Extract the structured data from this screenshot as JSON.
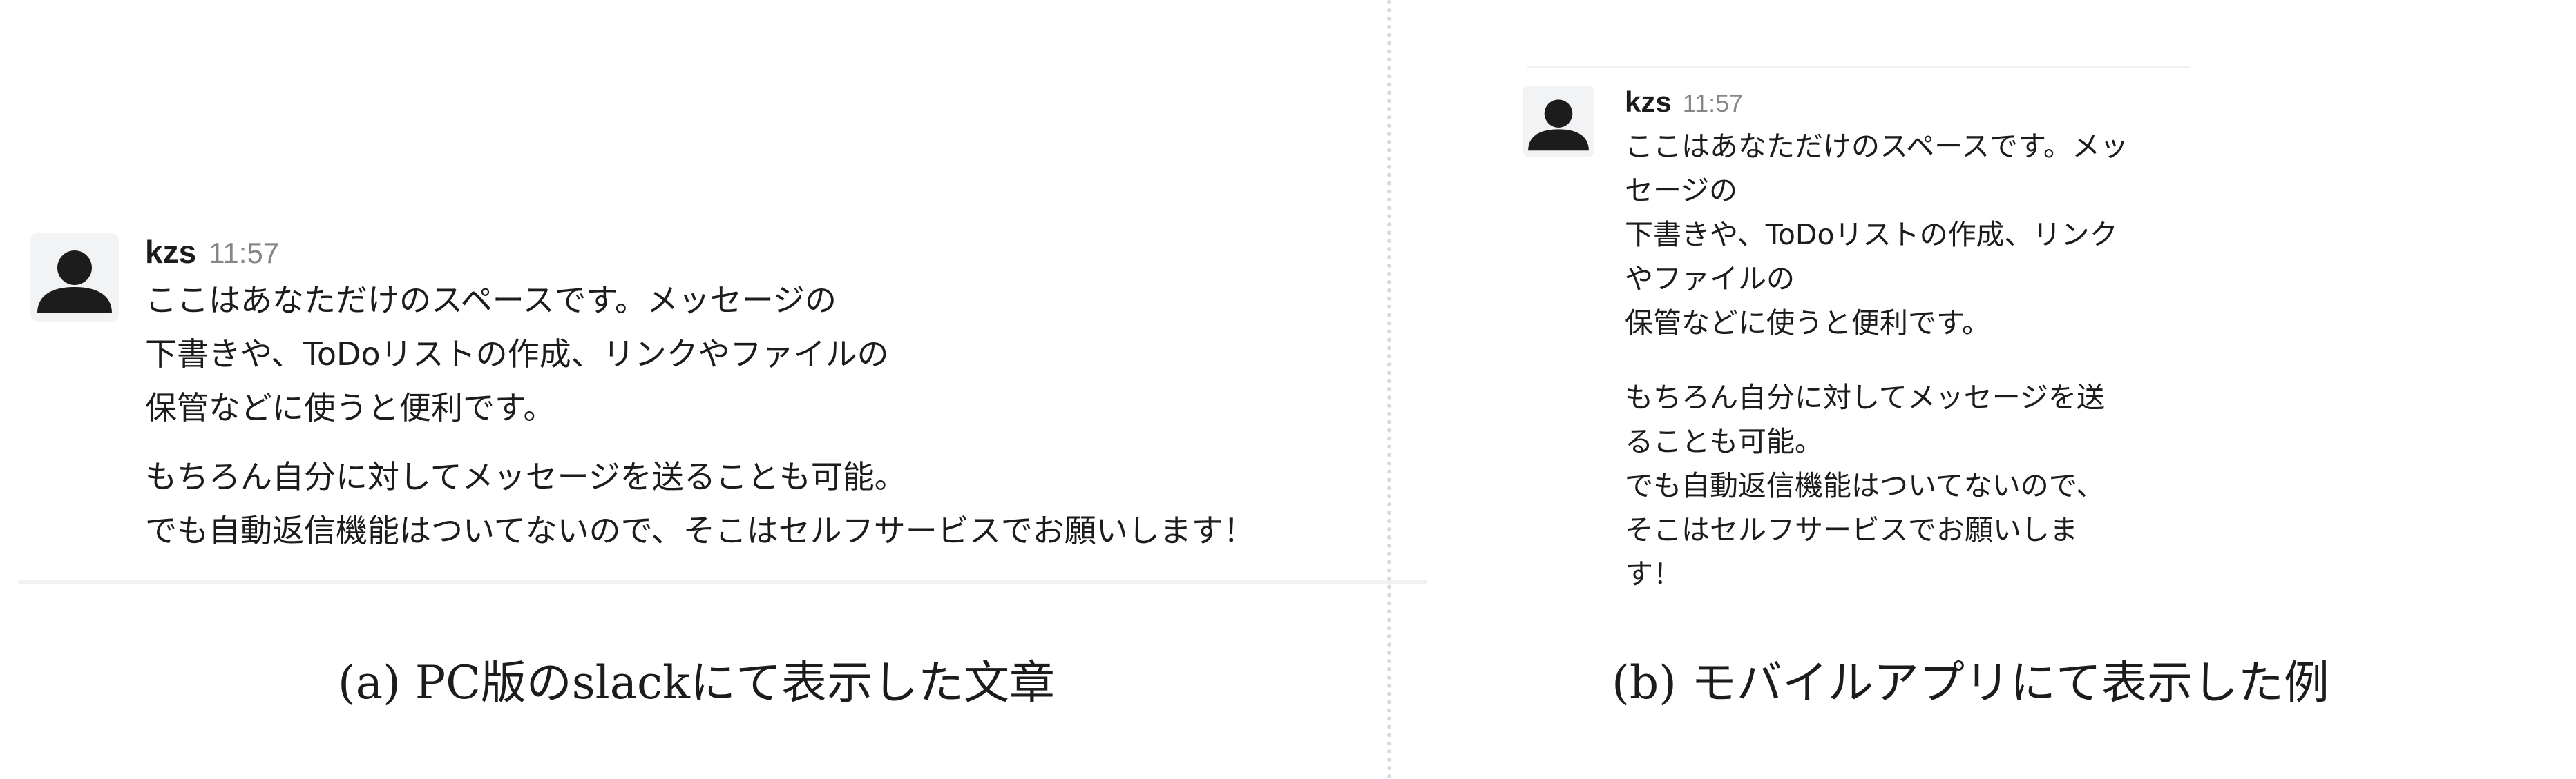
{
  "panel_a": {
    "message": {
      "user": "kzs",
      "time": "11:57",
      "paragraph1": [
        "ここはあなただけのスペースです。メッセージの",
        "下書きや、ToDoリストの作成、リンクやファイルの",
        "保管などに使うと便利です。"
      ],
      "paragraph2": [
        "もちろん自分に対してメッセージを送ることも可能。",
        "でも自動返信機能はついてないので、そこはセルフサービスでお願いします！"
      ]
    },
    "caption": "(a) PC版のslackにて表示した文章"
  },
  "panel_b": {
    "message": {
      "user": "kzs",
      "time": "11:57",
      "paragraph1": [
        "ここはあなただけのスペースです。メッ",
        "セージの",
        "下書きや、ToDoリストの作成、リンク",
        "やファイルの",
        "保管などに使うと便利です。"
      ],
      "paragraph2": [
        "もちろん自分に対してメッセージを送",
        "ることも可能。",
        "でも自動返信機能はついてないので、",
        "そこはセルフサービスでお願いしま",
        "す！"
      ]
    },
    "caption": "(b)  モバイルアプリにて表示した例"
  },
  "icons": {
    "avatar": "person-silhouette-icon"
  },
  "colors": {
    "text": "#1d1c1d",
    "timestamp": "#868686",
    "avatar_bg": "#f2f3f5"
  }
}
